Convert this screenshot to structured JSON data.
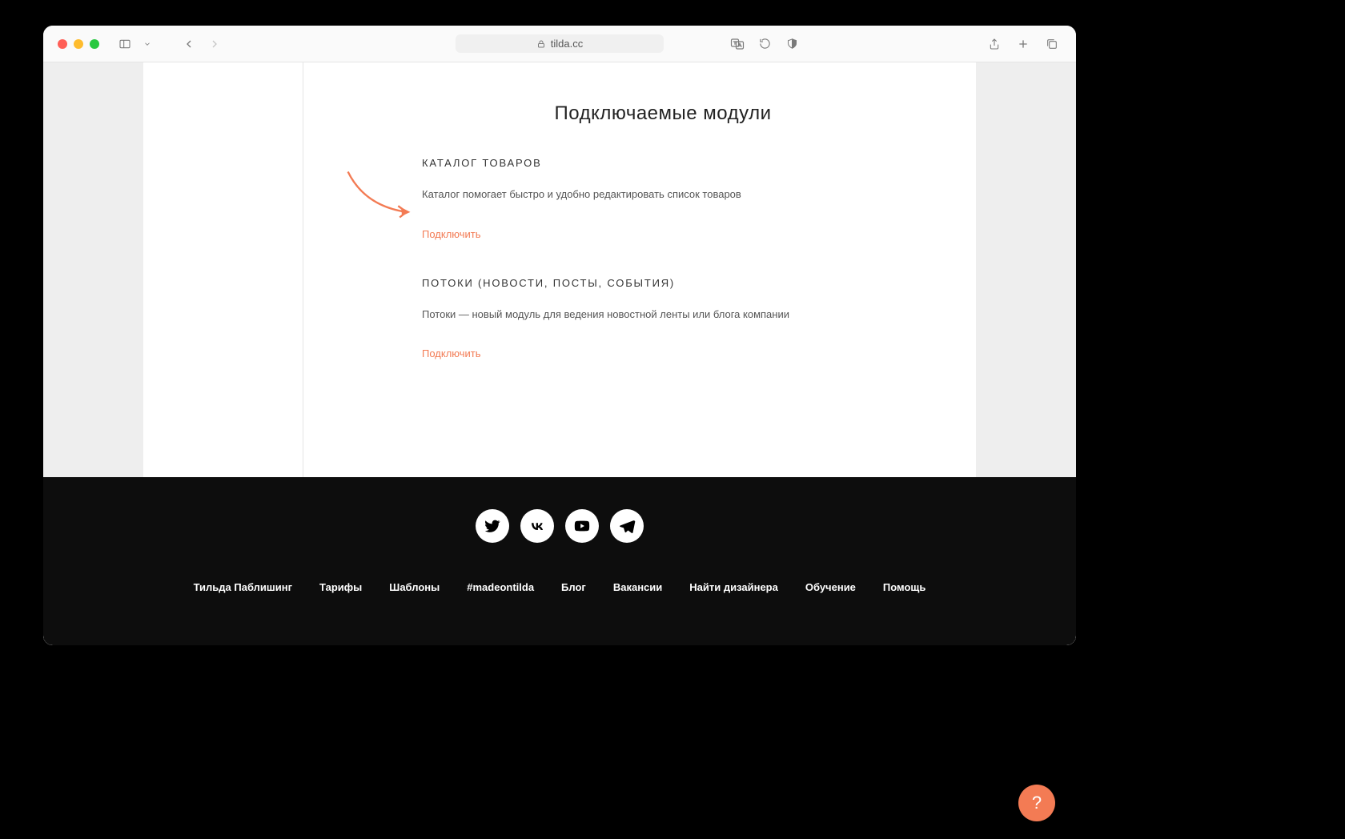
{
  "browser": {
    "url_host": "tilda.cc"
  },
  "page": {
    "section_title": "Подключаемые модули",
    "modules": [
      {
        "heading": "КАТАЛОГ ТОВАРОВ",
        "description": "Каталог помогает быстро и удобно редактировать список товаров",
        "link_label": "Подключить"
      },
      {
        "heading": "ПОТОКИ (НОВОСТИ, ПОСТЫ, СОБЫТИЯ)",
        "description": "Потоки — новый модуль для ведения новостной ленты или блога компании",
        "link_label": "Подключить"
      }
    ]
  },
  "footer": {
    "links": [
      "Тильда Паблишинг",
      "Тарифы",
      "Шаблоны",
      "#madeontilda",
      "Блог",
      "Вакансии",
      "Найти дизайнера",
      "Обучение",
      "Помощь"
    ]
  },
  "help_label": "?"
}
